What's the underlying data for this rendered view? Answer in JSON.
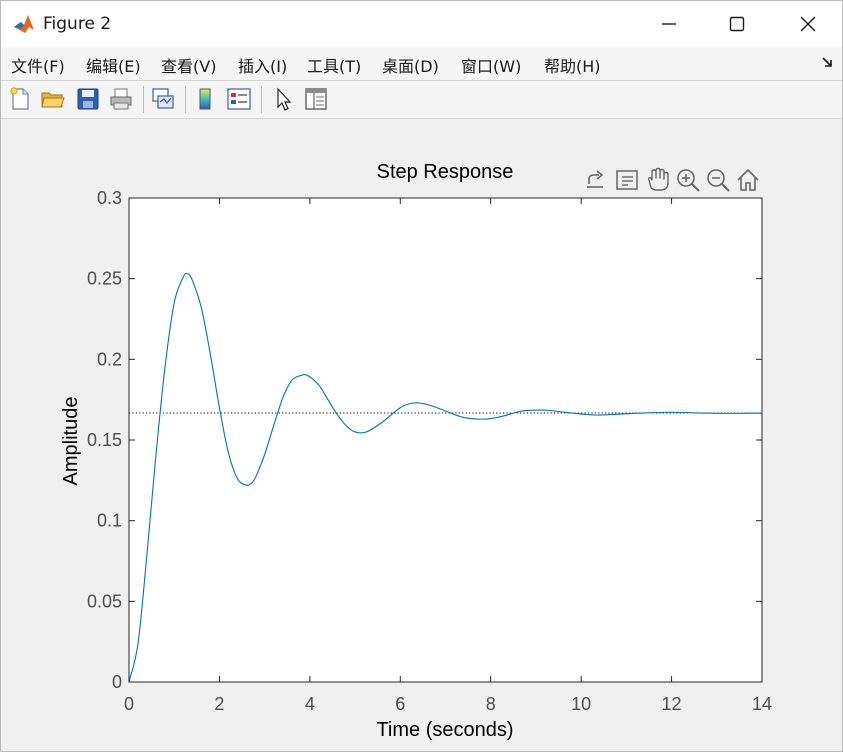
{
  "window": {
    "title": "Figure 2"
  },
  "menu": {
    "items": [
      "文件(F)",
      "编辑(E)",
      "查看(V)",
      "插入(I)",
      "工具(T)",
      "桌面(D)",
      "窗口(W)",
      "帮助(H)"
    ]
  },
  "colors": {
    "line": "#0072bd",
    "axes_text": "#4d4d4d",
    "title_text": "#000000",
    "reference_line": "#000000"
  },
  "chart_data": {
    "type": "line",
    "title": "Step Response",
    "xlabel": "Time (seconds)",
    "ylabel": "Amplitude",
    "xlim": [
      0,
      14
    ],
    "ylim": [
      0,
      0.3
    ],
    "xticks": [
      "0",
      "2",
      "4",
      "6",
      "8",
      "10",
      "12",
      "14"
    ],
    "yticks": [
      "0",
      "0.05",
      "0.1",
      "0.15",
      "0.2",
      "0.25",
      "0.3"
    ],
    "grid": false,
    "reference_value": 0.1667,
    "x": [
      0,
      0.2,
      0.4,
      0.6,
      0.8,
      1.0,
      1.2,
      1.3,
      1.4,
      1.6,
      1.8,
      2.0,
      2.2,
      2.4,
      2.6,
      2.7,
      2.8,
      3.0,
      3.2,
      3.4,
      3.6,
      3.8,
      3.95,
      4.2,
      4.4,
      4.6,
      4.8,
      5.0,
      5.25,
      5.6,
      6.0,
      6.3,
      6.6,
      7.0,
      7.4,
      7.9,
      8.3,
      8.7,
      9.2,
      9.7,
      10.3,
      10.8,
      11.4,
      12.0,
      12.6,
      13.2,
      14.0
    ],
    "y": [
      0,
      0.024,
      0.08,
      0.142,
      0.196,
      0.235,
      0.251,
      0.253,
      0.249,
      0.232,
      0.203,
      0.17,
      0.142,
      0.126,
      0.122,
      0.123,
      0.127,
      0.141,
      0.159,
      0.176,
      0.187,
      0.19,
      0.19,
      0.184,
      0.175,
      0.166,
      0.159,
      0.155,
      0.155,
      0.161,
      0.17,
      0.173,
      0.172,
      0.168,
      0.164,
      0.163,
      0.165,
      0.168,
      0.1685,
      0.167,
      0.1655,
      0.166,
      0.1668,
      0.1672,
      0.1668,
      0.1665,
      0.1667
    ]
  }
}
